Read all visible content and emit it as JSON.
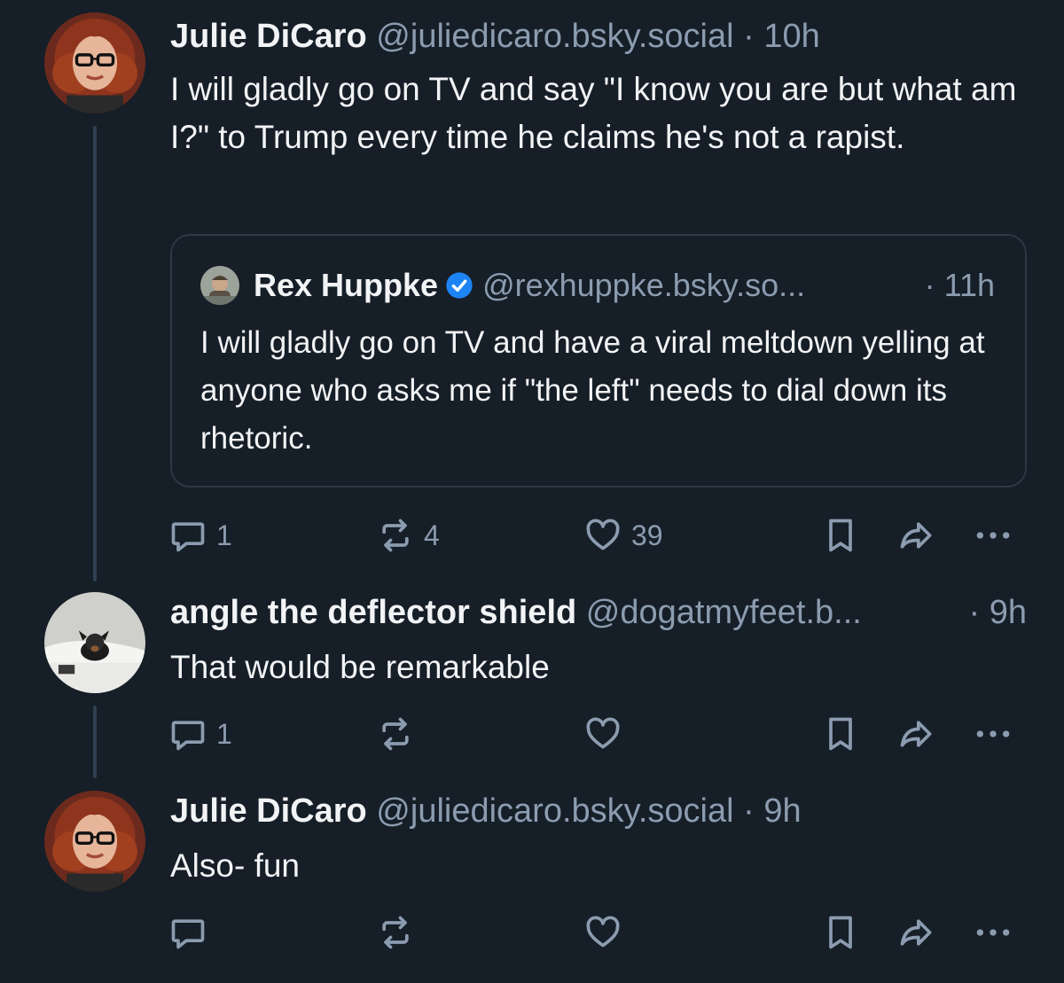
{
  "posts": [
    {
      "author": "Julie DiCaro",
      "handle": "@juliedicaro.bsky.social",
      "separator": "·",
      "time": "10h",
      "text": "I will gladly go on TV and say \"I know you are but what am I?\" to Trump every time he claims he's not a rapist.",
      "quote": {
        "author": "Rex Huppke",
        "handle": "@rexhuppke.bsky.so...",
        "time": "· 11h",
        "text": "I will gladly go on TV and have a viral meltdown yelling at anyone who asks me if \"the left\" needs to dial down its rhetoric."
      },
      "actions": {
        "reply_count": "1",
        "repost_count": "4",
        "like_count": "39"
      }
    },
    {
      "author": "angle the deflector shield",
      "handle": "@dogatmyfeet.b...",
      "separator": "",
      "time": "· 9h",
      "text": "That would be remarkable",
      "actions": {
        "reply_count": "1",
        "repost_count": "",
        "like_count": ""
      }
    },
    {
      "author": "Julie DiCaro",
      "handle": "@juliedicaro.bsky.social",
      "separator": "·",
      "time": "9h",
      "text": "Also- fun",
      "actions": {
        "reply_count": "",
        "repost_count": "",
        "like_count": ""
      }
    }
  ],
  "icons": {
    "reply": "reply-icon",
    "repost": "repost-icon",
    "like": "heart-icon",
    "bookmark": "bookmark-icon",
    "share": "share-icon",
    "more": "more-icon",
    "verified": "verified-badge-icon"
  },
  "colors": {
    "background": "#161e27",
    "text": "#f1f3f5",
    "muted": "#8c9cb0",
    "thread_line": "#2e4052",
    "verified": "#1d84f5"
  }
}
